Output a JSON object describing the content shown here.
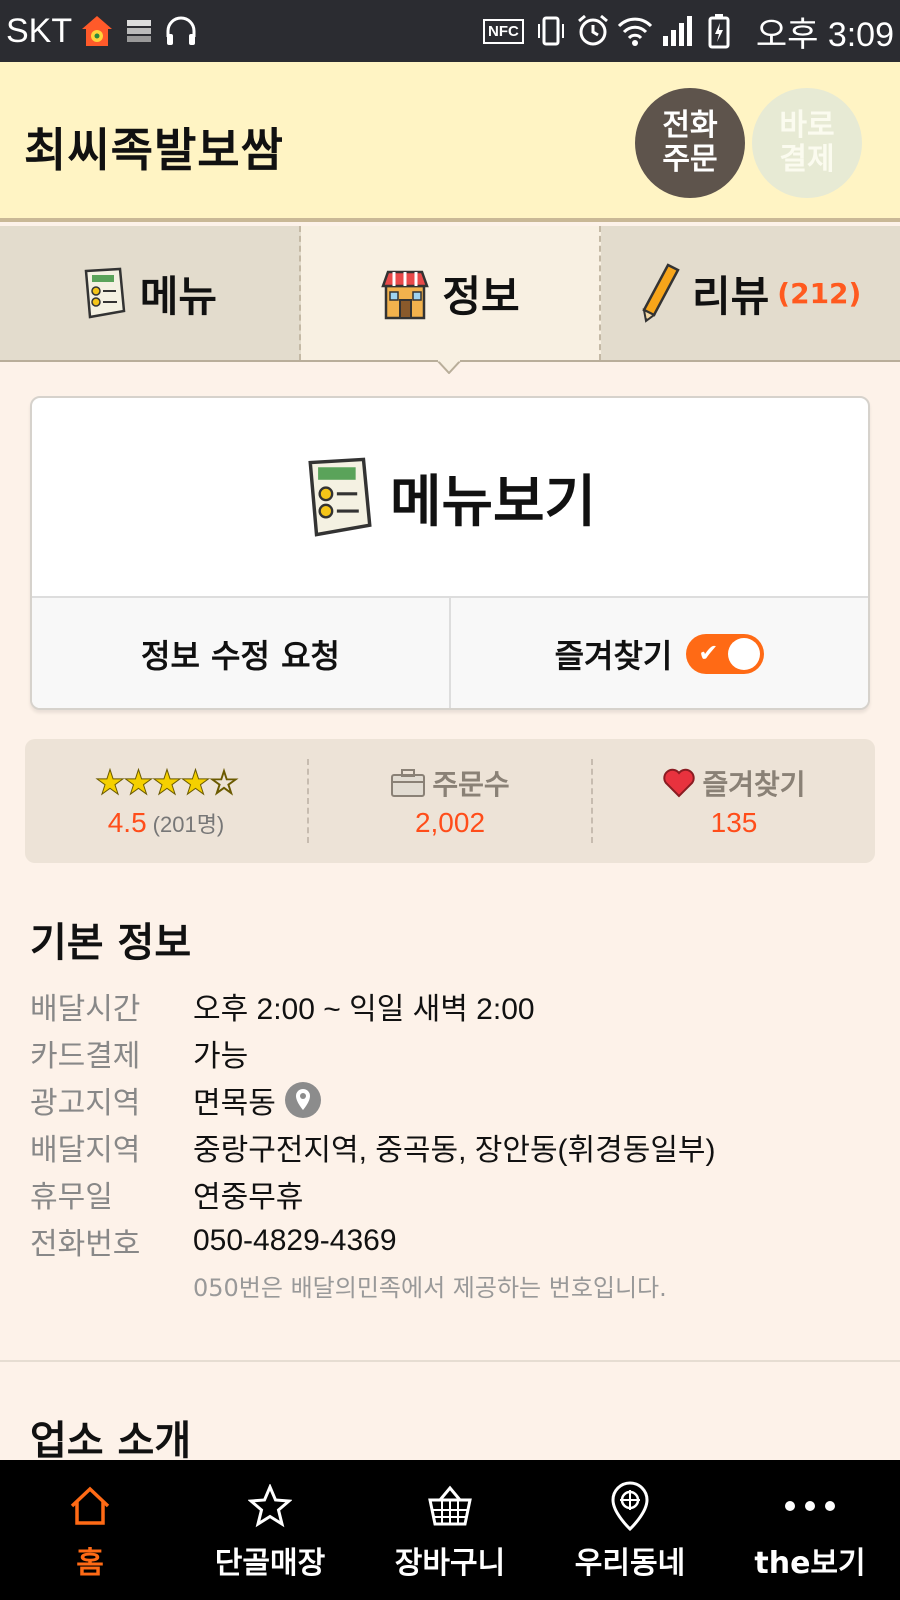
{
  "status_bar": {
    "carrier": "SKT",
    "nfc": "NFC",
    "time": "오후 3:09"
  },
  "header": {
    "title": "최씨족발보쌈",
    "call_order": "전화\n주문",
    "direct_pay": "바로\n결제"
  },
  "tabs": [
    {
      "label": "메뉴",
      "icon": "menu-doc-icon"
    },
    {
      "label": "정보",
      "icon": "store-icon"
    },
    {
      "label": "리뷰",
      "count": "(212)",
      "icon": "pencil-icon"
    }
  ],
  "menu_card": {
    "menu_view": "메뉴보기",
    "edit_request": "정보 수정 요청",
    "favorite": "즐겨찾기",
    "favorite_on": true
  },
  "stats": {
    "rating": {
      "stars": "★★★★☆",
      "value": "4.5",
      "count": "(201명)"
    },
    "orders": {
      "label": "주문수",
      "value": "2,002"
    },
    "favorites": {
      "label": "즐겨찾기",
      "value": "135"
    }
  },
  "basic_info": {
    "title": "기본 정보",
    "rows": [
      {
        "label": "배달시간",
        "value": "오후 2:00 ~ 익일 새벽 2:00"
      },
      {
        "label": "카드결제",
        "value": "가능"
      },
      {
        "label": "광고지역",
        "value": "면목동"
      },
      {
        "label": "배달지역",
        "value": "중랑구전지역, 중곡동, 장안동(휘경동일부)"
      },
      {
        "label": "휴무일",
        "value": "연중무휴"
      },
      {
        "label": "전화번호",
        "value": "050-4829-4369"
      }
    ],
    "phone_note": "050번은 배달의민족에서 제공하는 번호입니다."
  },
  "intro": {
    "title": "업소 소개"
  },
  "bottom_nav": [
    {
      "label": "홈",
      "icon": "home-icon"
    },
    {
      "label": "단골매장",
      "icon": "star-icon"
    },
    {
      "label": "장바구니",
      "icon": "basket-icon"
    },
    {
      "label": "우리동네",
      "icon": "location-icon"
    },
    {
      "label": "the보기",
      "icon": "more-icon"
    }
  ],
  "colors": {
    "accent": "#ff6a15",
    "header_bg": "#fff4c4",
    "page_bg": "#fdf2e9"
  }
}
